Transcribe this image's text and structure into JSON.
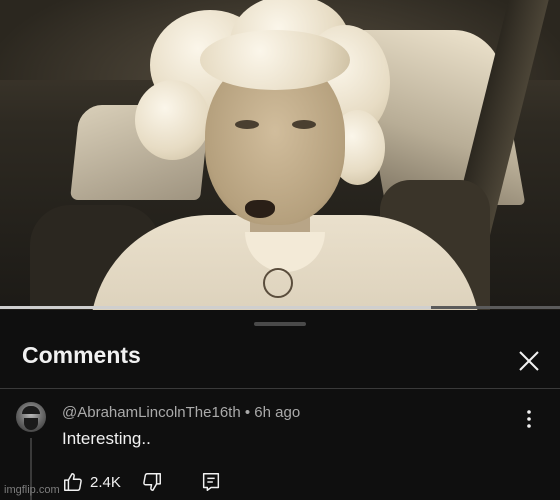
{
  "video": {
    "progress": 0.77
  },
  "comments_panel": {
    "title": "Comments",
    "close_icon": "close-icon"
  },
  "comment": {
    "author": "@AbrahamLincolnThe16th",
    "separator": "•",
    "time": "6h ago",
    "text": "Interesting..",
    "like_count": "2.4K",
    "icons": [
      "thumbs-up-icon",
      "thumbs-down-icon",
      "reply-icon",
      "more-vert-icon"
    ]
  },
  "watermark": "imgflip.com",
  "colors": {
    "background": "#0f0f0f",
    "text_primary": "#f1f1f1",
    "text_secondary": "#aaaaaa"
  }
}
